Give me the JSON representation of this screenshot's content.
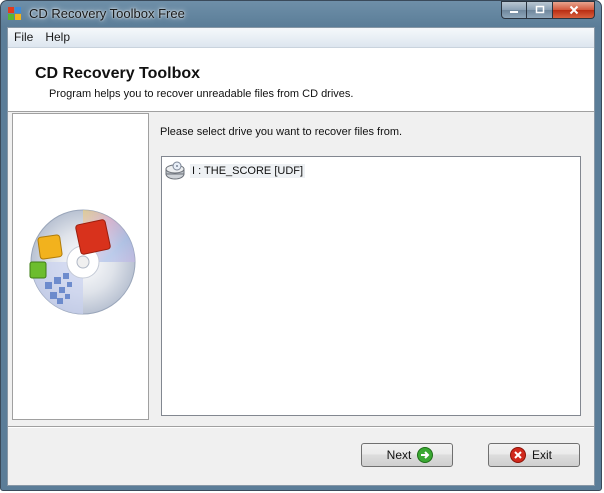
{
  "window": {
    "title": "CD Recovery Toolbox Free"
  },
  "menu": {
    "items": [
      "File",
      "Help"
    ]
  },
  "header": {
    "title": "CD Recovery Toolbox",
    "subtitle": "Program helps you to recover unreadable files from CD drives."
  },
  "main": {
    "prompt": "Please select drive you want to recover files from.",
    "drives": [
      {
        "label": "I : THE_SCORE [UDF]",
        "icon": "cd-drive-icon"
      }
    ]
  },
  "buttons": {
    "next_label": "Next",
    "exit_label": "Exit"
  },
  "colors": {
    "next_icon": "#3aa832",
    "exit_icon": "#d0281c"
  }
}
